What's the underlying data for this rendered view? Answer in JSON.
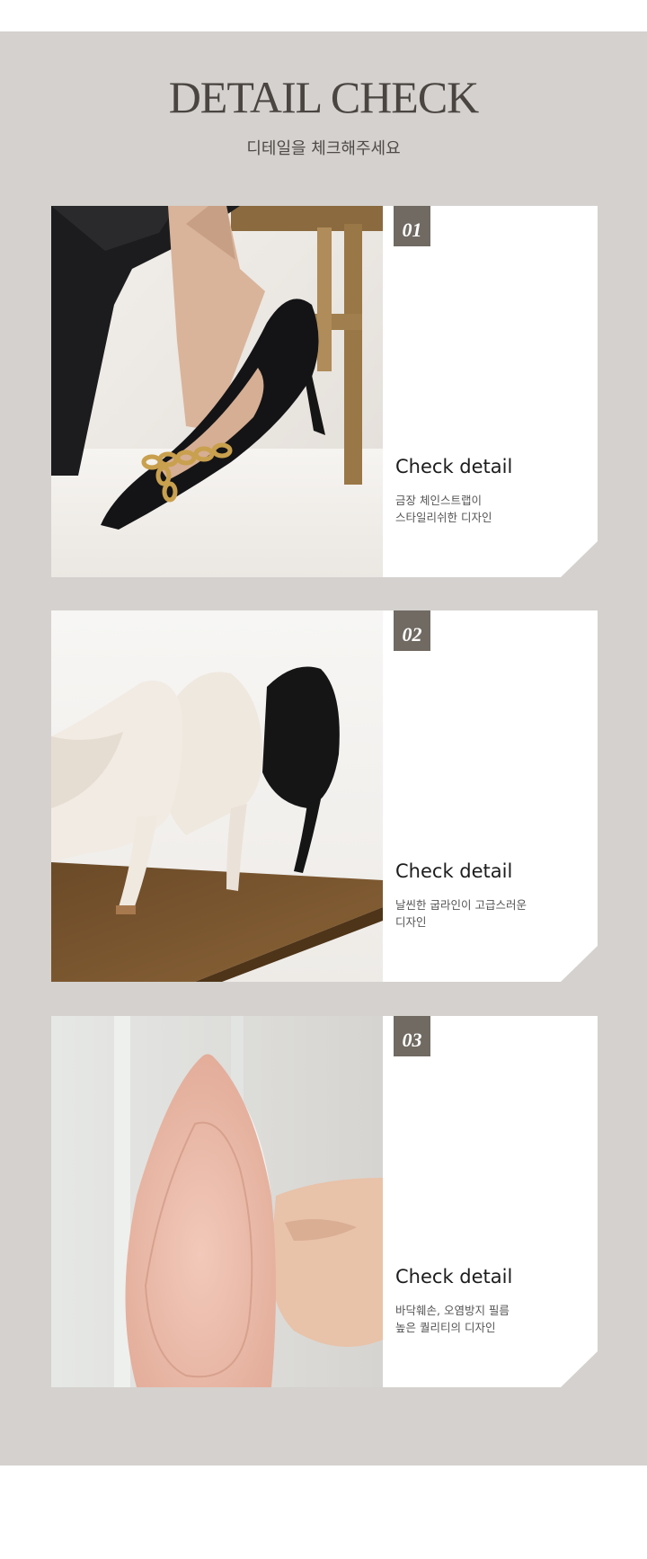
{
  "header": {
    "title": "DETAIL CHECK",
    "subtitle": "디테일을 체크해주세요"
  },
  "details": [
    {
      "number": "01",
      "heading": "Check detail",
      "line1": "금장 체인스트랩이",
      "line2": "스타일리쉬한 디자인"
    },
    {
      "number": "02",
      "heading": "Check detail",
      "line1": "날씬한 굽라인이 고급스러운",
      "line2": "디자인"
    },
    {
      "number": "03",
      "heading": "Check detail",
      "line1": "바닥훼손, 오염방지 필름",
      "line2": "높은 퀄리티의 디자인"
    }
  ],
  "colors": {
    "section_background": "#d4d1ce",
    "number_badge": "#706a62",
    "title_text": "#4a4541"
  }
}
